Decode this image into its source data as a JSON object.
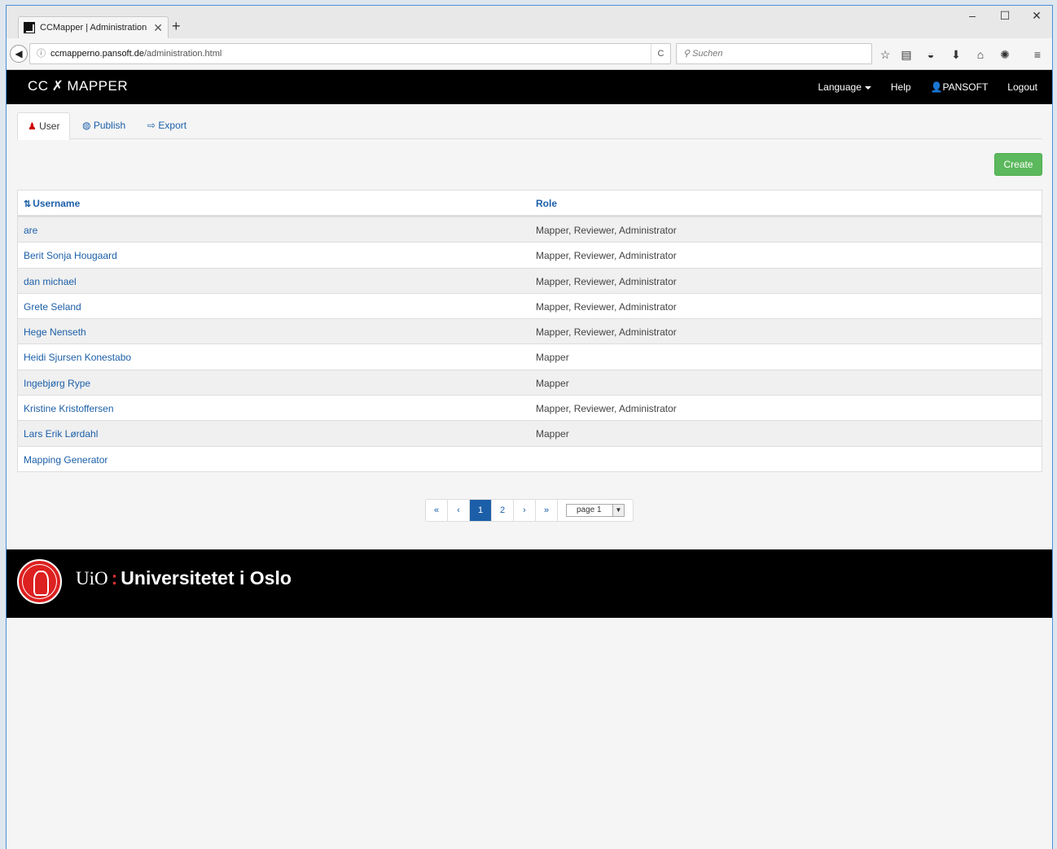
{
  "browser": {
    "tab_title": "CCMapper | Administration",
    "tab_close": "✕",
    "new_tab": "+",
    "window_controls": [
      "–",
      "☐",
      "✕"
    ],
    "url_host": "ccmapperno.pansoft.de",
    "url_path": "/administration.html",
    "url_prefix_icon": "ⓘ",
    "reload": "C",
    "search_placeholder": "Suchen",
    "toolbar_icons": [
      "star-icon",
      "reader-icon",
      "pocket-icon",
      "download-icon",
      "home-icon",
      "extension-icon",
      "menu-icon"
    ]
  },
  "app": {
    "brand_left": "CC",
    "brand_right": "MAPPER",
    "nav": {
      "language": "Language",
      "help": "Help",
      "user": "PANSOFT",
      "logout": "Logout"
    }
  },
  "tabs": [
    {
      "label": "User",
      "active": true
    },
    {
      "label": "Publish",
      "active": false
    },
    {
      "label": "Export",
      "active": false
    }
  ],
  "actions": {
    "create": "Create"
  },
  "table": {
    "headers": {
      "username": "Username",
      "role": "Role"
    },
    "rows": [
      {
        "username": "are",
        "role": "Mapper, Reviewer, Administrator"
      },
      {
        "username": "Berit Sonja Hougaard",
        "role": "Mapper, Reviewer, Administrator"
      },
      {
        "username": "dan michael",
        "role": "Mapper, Reviewer, Administrator"
      },
      {
        "username": "Grete Seland",
        "role": "Mapper, Reviewer, Administrator"
      },
      {
        "username": "Hege Nenseth",
        "role": "Mapper, Reviewer, Administrator"
      },
      {
        "username": "Heidi Sjursen Konestabo",
        "role": "Mapper"
      },
      {
        "username": "Ingebjørg Rype",
        "role": "Mapper"
      },
      {
        "username": "Kristine Kristoffersen",
        "role": "Mapper, Reviewer, Administrator"
      },
      {
        "username": "Lars Erik Lørdahl",
        "role": "Mapper"
      },
      {
        "username": "Mapping Generator",
        "role": ""
      }
    ]
  },
  "pagination": {
    "first": "«",
    "prev": "‹",
    "pages": [
      "1",
      "2"
    ],
    "current": "1",
    "next": "›",
    "last": "»",
    "select_value": "page 1"
  },
  "footer": {
    "uio": "UiO",
    "dots": ":",
    "name": "Universitetet i Oslo"
  }
}
